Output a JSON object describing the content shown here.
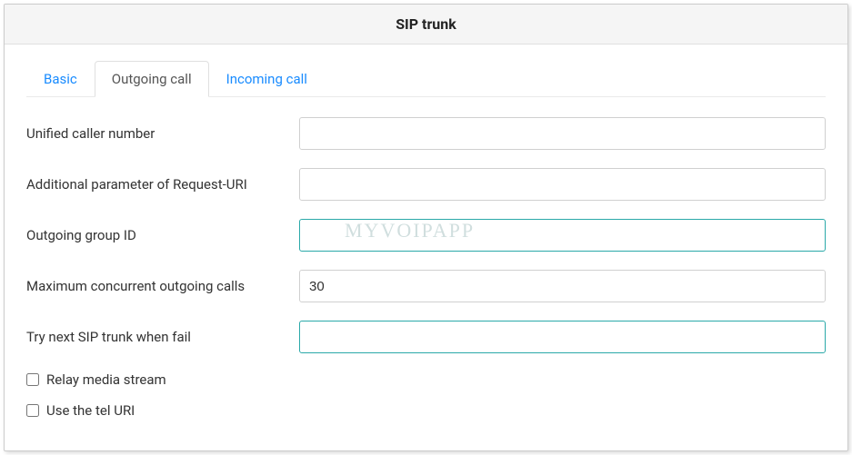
{
  "header": {
    "title": "SIP trunk"
  },
  "tabs": [
    {
      "label": "Basic",
      "active": false
    },
    {
      "label": "Outgoing call",
      "active": true
    },
    {
      "label": "Incoming call",
      "active": false
    }
  ],
  "form": {
    "unified_caller": {
      "label": "Unified caller number",
      "value": ""
    },
    "additional_param": {
      "label": "Additional parameter of Request-URI",
      "value": ""
    },
    "outgoing_group": {
      "label": "Outgoing group ID",
      "value": ""
    },
    "max_concurrent": {
      "label": "Maximum concurrent outgoing calls",
      "value": "30"
    },
    "try_next": {
      "label": "Try next SIP trunk when fail",
      "value": ""
    },
    "relay_media": {
      "label": "Relay media stream",
      "checked": false
    },
    "use_tel_uri": {
      "label": "Use the tel URI",
      "checked": false
    }
  },
  "watermark": "MYVOIPAPP"
}
